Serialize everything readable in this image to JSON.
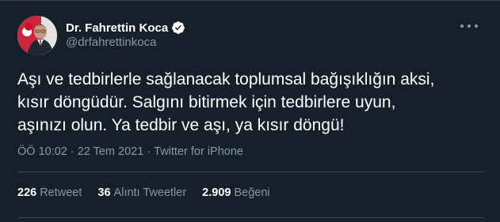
{
  "tweet": {
    "author": {
      "name": "Dr. Fahrettin Koca",
      "handle": "@drfahrettinkoca",
      "verified_icon": "verified-badge-icon",
      "avatar": "author-photo-with-turkish-flag"
    },
    "more_icon": "more-options-icon",
    "text": "Aşı ve tedbirlerle sağlanacak toplumsal bağışıklığın aksi,\nkısır döngüdür. Salgını bitirmek için tedbirlere uyun,\naşınızı olun. Ya tedbir ve aşı, ya kısır döngü!",
    "time": "ÖÖ 10:02",
    "date": "22 Tem 2021",
    "source": "Twitter for iPhone",
    "separator": "·",
    "stats": {
      "retweets": {
        "count": "226",
        "label": "Retweet"
      },
      "quotes": {
        "count": "36",
        "label": "Alıntı Tweetler"
      },
      "likes": {
        "count": "2.909",
        "label": "Beğeni"
      }
    }
  },
  "colors": {
    "background": "#15202b",
    "text": "#ffffff",
    "secondary_text": "#8899a6",
    "divider": "#38444d",
    "verified": "#ffffff"
  }
}
